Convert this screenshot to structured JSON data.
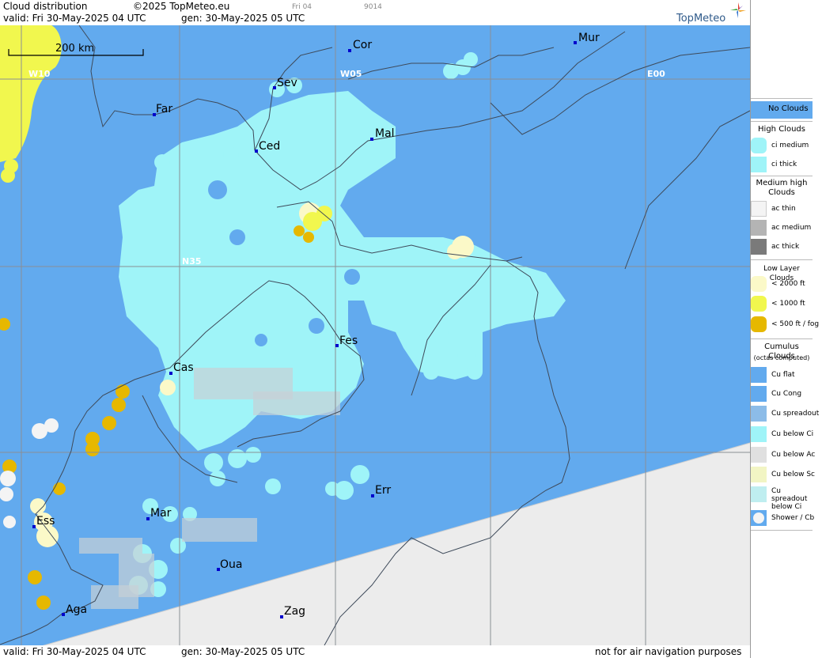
{
  "header": {
    "title": "Cloud distribution",
    "copyright": "©2025 TopMeteo.eu",
    "faint_1": "Fri 04",
    "faint_2": "9014",
    "valid": "valid:  Fri  30-May-2025  04 UTC",
    "gen": "gen: 30-May-2025 05 UTC",
    "brand": "TopMeteo"
  },
  "map": {
    "scale_label": "200 km",
    "grid_labels": [
      "W10",
      "W05",
      "E00",
      "N35"
    ],
    "cities": [
      "Cor",
      "Mur",
      "Sev",
      "Far",
      "Ced",
      "Mal",
      "Cas",
      "Fes",
      "Ess",
      "Mar",
      "Err",
      "Oua",
      "Aga",
      "Zag"
    ]
  },
  "footer": {
    "valid": "valid:  Fri  30-May-2025  04 UTC",
    "gen": "gen: 30-May-2025 05 UTC",
    "disclaimer": "not for air navigation purposes"
  },
  "legend": {
    "no_clouds": "No Clouds",
    "high_head": "High Clouds",
    "ci_medium": "ci medium",
    "ci_thick": "ci thick",
    "medium_head": "Medium high Clouds",
    "ac_thin": "ac thin",
    "ac_medium": "ac medium",
    "ac_thick": "ac thick",
    "low_head": "Low Layer Clouds",
    "low_2000": "< 2000 ft",
    "low_1000": "< 1000 ft",
    "low_500": "< 500 ft / fog",
    "cumulus_head": "Cumulus Clouds",
    "cumulus_sub": "(octas computed)",
    "cu_flat": "Cu flat",
    "cu_cong": "Cu Cong",
    "cu_spreadout": "Cu spreadout",
    "cu_below_ci": "Cu below Ci",
    "cu_below_ac": "Cu below Ac",
    "cu_below_sc": "Cu below Sc",
    "cu_spreadout_ci": "Cu spreadout below Ci",
    "shower_cb": "Shower / Cb",
    "colors": {
      "no_clouds": "#62aaee",
      "ci": "#9ff4f8",
      "ac_thin": "#f4f4f4",
      "ac_medium": "#b4b4b4",
      "ac_thick": "#7a7a7a",
      "low_2000": "#fbf9c8",
      "low_1000": "#f1f74e",
      "low_500": "#e6b800",
      "outside": "#ececec"
    }
  }
}
